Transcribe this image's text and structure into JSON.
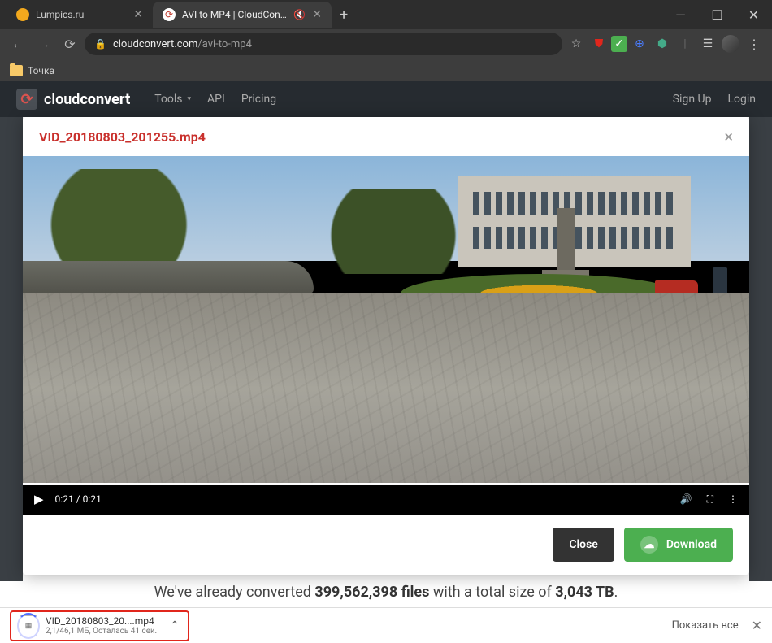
{
  "browser": {
    "tabs": [
      {
        "title": "Lumpics.ru",
        "favicon_color": "#f2a81d",
        "active": false
      },
      {
        "title": "AVI to MP4 | CloudConvert",
        "favicon_color": "#c0392b",
        "active": true,
        "muted": true
      }
    ],
    "url_host": "cloudconvert.com",
    "url_path": "/avi-to-mp4",
    "bookmarks": {
      "folder_label": "Точка"
    },
    "window": {
      "minimize": "—",
      "maximize": "☐",
      "close": "✕"
    }
  },
  "cloudconvert": {
    "brand_light": "cloud",
    "brand_bold": "convert",
    "nav": {
      "tools": "Tools",
      "api": "API",
      "pricing": "Pricing"
    },
    "auth": {
      "signup": "Sign Up",
      "login": "Login"
    },
    "converted_prefix": "We've already converted ",
    "converted_count": "399,562,398",
    "converted_mid": " files",
    "converted_suffix1": " with a total size of ",
    "converted_size": "3,043 TB",
    "converted_tail": "."
  },
  "modal": {
    "filename": "VID_20180803_201255.mp4",
    "close_x": "×",
    "actions": {
      "close": "Close",
      "download": "Download"
    }
  },
  "video": {
    "time": "0:21 / 0:21"
  },
  "download_shelf": {
    "file_name": "VID_20180803_20....mp4",
    "file_rate": "2,1/46,1 МБ, Осталась 41 сек.",
    "show_all": "Показать все"
  }
}
